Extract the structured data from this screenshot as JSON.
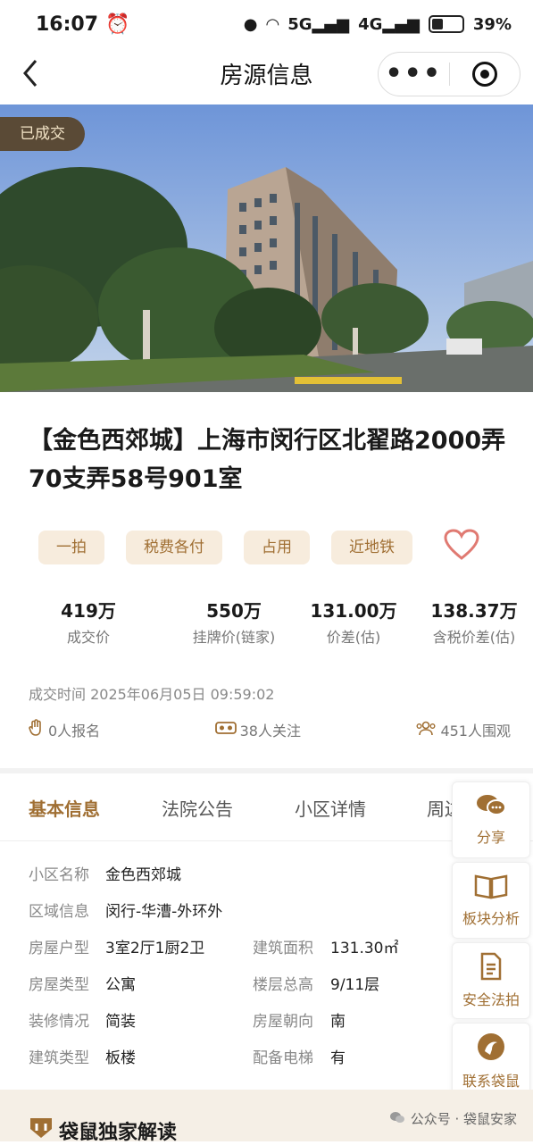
{
  "status_bar": {
    "time": "16:07",
    "battery": "39%"
  },
  "nav": {
    "title": "房源信息"
  },
  "hero": {
    "badge": "已成交"
  },
  "listing": {
    "title": "【金色西郊城】上海市闵行区北翟路2000弄70支弄58号901室"
  },
  "tags": [
    "一拍",
    "税费各付",
    "占用",
    "近地铁"
  ],
  "stats": [
    {
      "value": "419万",
      "label": "成交价"
    },
    {
      "value": "550万",
      "label": "挂牌价(链家)"
    },
    {
      "value": "131.00万",
      "label": "价差(估)"
    },
    {
      "value": "138.37万",
      "label": "含税价差(估)"
    }
  ],
  "deal_time": "成交时间 2025年06月05日 09:59:02",
  "counters": {
    "signups": "0人报名",
    "followers": "38人关注",
    "watchers": "451人围观"
  },
  "tabs": [
    "基本信息",
    "法院公告",
    "小区详情",
    "周边"
  ],
  "basic_info": [
    {
      "k": "小区名称",
      "v": "金色西郊城"
    },
    {
      "k": "区域信息",
      "v": "闵行-华漕-外环外"
    },
    {
      "k": "房屋户型",
      "v": "3室2厅1厨2卫",
      "k2": "建筑面积",
      "v2": "131.30㎡"
    },
    {
      "k": "房屋类型",
      "v": "公寓",
      "k2": "楼层总高",
      "v2": "9/11层"
    },
    {
      "k": "装修情况",
      "v": "简装",
      "k2": "房屋朝向",
      "v2": "南"
    },
    {
      "k": "建筑类型",
      "v": "板楼",
      "k2": "配备电梯",
      "v2": "有"
    }
  ],
  "floating": {
    "share": "分享",
    "analysis": "板块分析",
    "auction": "安全法拍",
    "contact": "联系袋鼠"
  },
  "footer": {
    "title": "袋鼠独家解读",
    "watermark": "公众号 · 袋鼠安家"
  },
  "colors": {
    "accent": "#a06f33",
    "tag_bg": "#f7ecdd",
    "badge_bg": "#5a4a36"
  }
}
